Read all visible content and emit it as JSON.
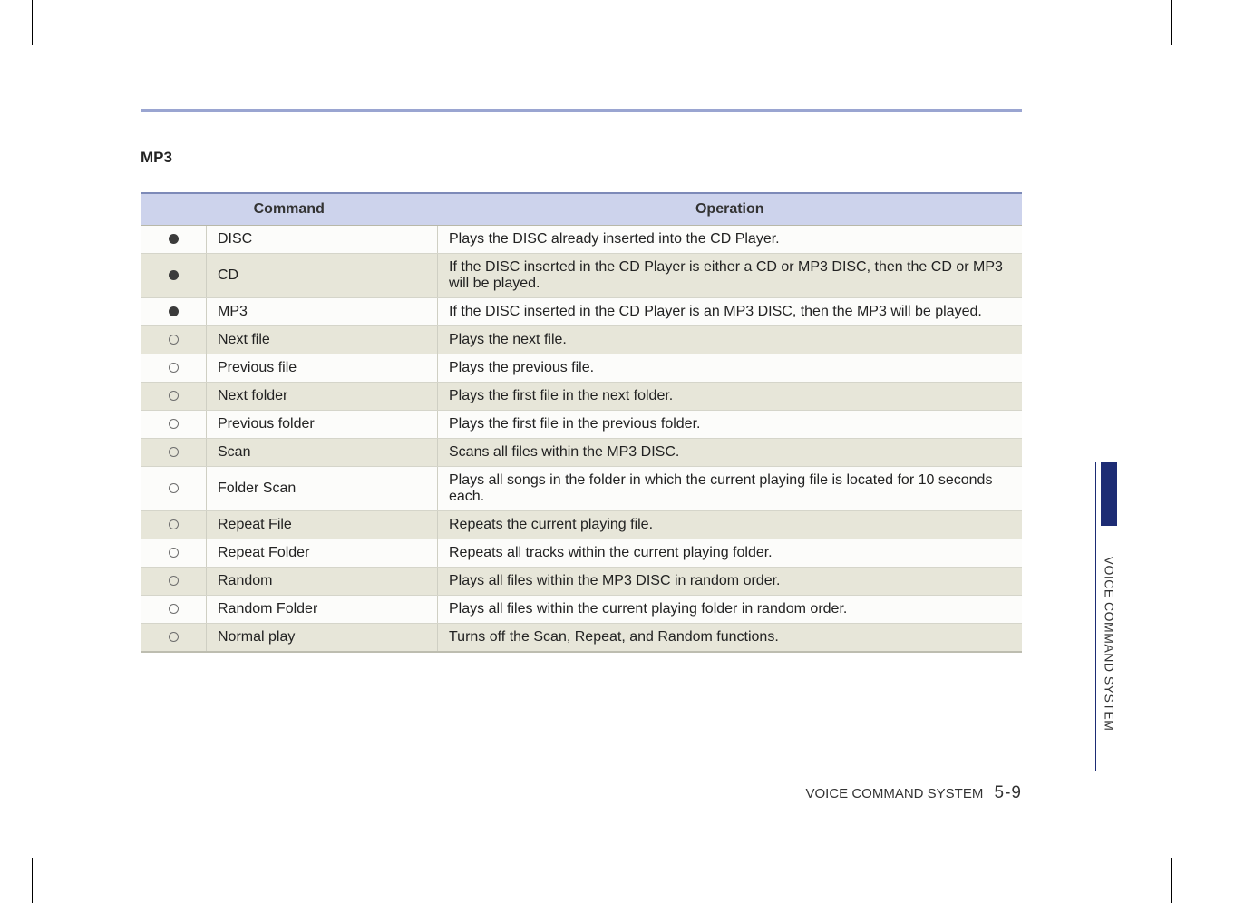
{
  "section_title": "MP3",
  "table": {
    "headers": {
      "command": "Command",
      "operation": "Operation"
    },
    "rows": [
      {
        "marker": "filled",
        "command": "DISC",
        "operation": "Plays the DISC already inserted into the CD Player."
      },
      {
        "marker": "filled",
        "command": "CD",
        "operation": "If the DISC inserted in the CD Player is either a CD or MP3 DISC, then the CD or MP3 will be played."
      },
      {
        "marker": "filled",
        "command": "MP3",
        "operation": "If the DISC inserted in the CD Player is an MP3 DISC, then the MP3 will be played."
      },
      {
        "marker": "hollow",
        "command": "Next file",
        "operation": "Plays the next file."
      },
      {
        "marker": "hollow",
        "command": "Previous file",
        "operation": "Plays the previous file."
      },
      {
        "marker": "hollow",
        "command": "Next folder",
        "operation": "Plays the first file in the next folder."
      },
      {
        "marker": "hollow",
        "command": "Previous folder",
        "operation": "Plays the first file in the previous folder."
      },
      {
        "marker": "hollow",
        "command": "Scan",
        "operation": "Scans all files within the MP3 DISC."
      },
      {
        "marker": "hollow",
        "command": "Folder Scan",
        "operation": "Plays all songs in the folder in which the current playing file is located for 10 seconds each."
      },
      {
        "marker": "hollow",
        "command": "Repeat File",
        "operation": "Repeats the current playing file."
      },
      {
        "marker": "hollow",
        "command": "Repeat Folder",
        "operation": "Repeats all tracks within the current playing folder."
      },
      {
        "marker": "hollow",
        "command": "Random",
        "operation": "Plays all files within the MP3 DISC in random order."
      },
      {
        "marker": "hollow",
        "command": "Random Folder",
        "operation": "Plays all files within the current playing folder in random order."
      },
      {
        "marker": "hollow",
        "command": "Normal play",
        "operation": "Turns off the Scan, Repeat, and Random functions."
      }
    ]
  },
  "side_label": "VOICE COMMAND SYSTEM",
  "footer": {
    "text": "VOICE COMMAND SYSTEM",
    "page": "5-9"
  }
}
